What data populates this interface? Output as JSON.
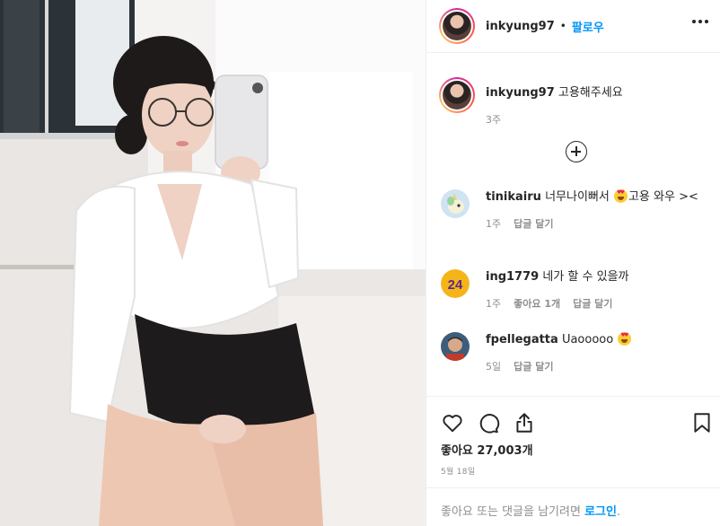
{
  "post": {
    "username": "inkyung97",
    "dot": "•",
    "follow_label": "팔로우",
    "caption_text": "고용해주세요",
    "caption_time": "3주"
  },
  "comments": [
    {
      "user": "tinikairu",
      "text_before": "너무나이뻐서",
      "text_after": "고용 와우 ><",
      "time": "1주",
      "likes": "",
      "reply": "답글 달기",
      "avatar": "unicorn-avatar"
    },
    {
      "user": "ing1779",
      "text_before": "네가 할 수 있을까",
      "text_after": "",
      "time": "1주",
      "likes": "좋아요 1개",
      "reply": "답글 달기",
      "avatar": "number-24-avatar"
    },
    {
      "user": "fpellegatta",
      "text_before": "Uaooooo",
      "text_after": "",
      "time": "5일",
      "likes": "",
      "reply": "답글 달기",
      "avatar": "person-avatar"
    }
  ],
  "actions": {
    "likes_text": "좋아요 27,003개",
    "date_text": "5월 18일"
  },
  "login_prompt": {
    "text": "좋아요 또는 댓글을 남기려면",
    "link": "로그인",
    "period": "."
  },
  "icons": {
    "heart": "heart-icon",
    "comment": "comment-icon",
    "share": "share-icon",
    "bookmark": "bookmark-icon",
    "more": "more-options-icon",
    "load_more": "load-more-comments-icon",
    "emoji": "heart-eyes-emoji-icon"
  },
  "colors": {
    "accent": "#0095f6",
    "text": "#262626",
    "muted": "#8e8e8e",
    "border": "#efefef"
  }
}
